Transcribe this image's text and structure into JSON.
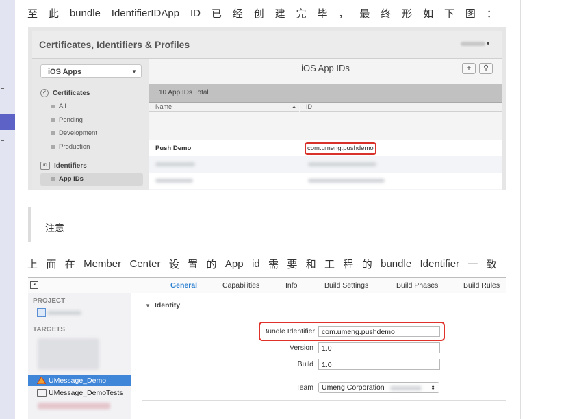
{
  "intro_line": [
    "至",
    "此",
    "bundle",
    "IdentifierIDApp",
    "ID",
    "已",
    "经",
    "创",
    "建",
    "完",
    "毕",
    "，",
    "最",
    "终",
    "形",
    "如",
    "下",
    "图",
    "："
  ],
  "portal": {
    "title": "Certificates, Identifiers & Profiles",
    "sidebar_select": "iOS Apps",
    "sections": [
      {
        "label": "Certificates",
        "icon": "certificate-icon",
        "items": [
          "All",
          "Pending",
          "Development",
          "Production"
        ]
      },
      {
        "label": "Identifiers",
        "icon": "id-icon",
        "items": [
          "App IDs"
        ]
      }
    ],
    "heading": "iOS App IDs",
    "add_button": "+",
    "search_button": "⚲",
    "total": "10 App IDs Total",
    "columns": [
      "Name",
      "ID"
    ],
    "rows": [
      {
        "name": "Push Demo",
        "id": "com.umeng.pushdemo"
      }
    ]
  },
  "note": {
    "label": "注意"
  },
  "second_line": [
    "上",
    "面",
    "在",
    "Member",
    "Center",
    "设",
    "置",
    "的",
    "App",
    "id",
    "需",
    "要",
    "和",
    "工",
    "程",
    "的",
    "bundle",
    "Identifier",
    "一",
    "致"
  ],
  "xcode": {
    "tabs": [
      "General",
      "Capabilities",
      "Info",
      "Build Settings",
      "Build Phases",
      "Build Rules"
    ],
    "active_tab": "General",
    "project_label": "PROJECT",
    "targets_label": "TARGETS",
    "targets": [
      "UMessage_Demo",
      "UMessage_DemoTests"
    ],
    "section": "Identity",
    "fields": {
      "bundle_label": "Bundle Identifier",
      "bundle_value": "com.umeng.pushdemo",
      "version_label": "Version",
      "version_value": "1.0",
      "build_label": "Build",
      "build_value": "1.0",
      "team_label": "Team",
      "team_value": "Umeng Corporation"
    }
  }
}
